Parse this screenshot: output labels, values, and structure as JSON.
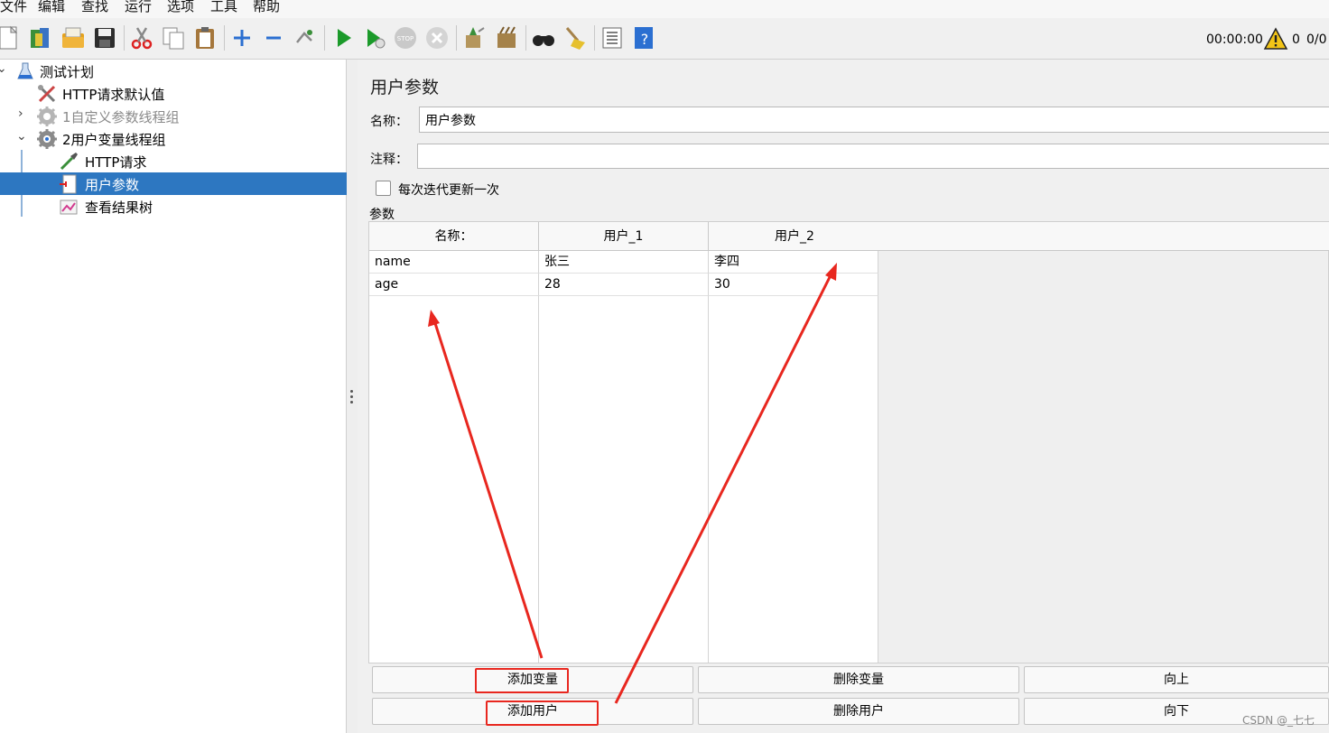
{
  "menu": [
    "文件",
    "编辑",
    "查找",
    "运行",
    "选项",
    "工具",
    "帮助"
  ],
  "toolbar": {
    "timer": "00:00:00",
    "warning_count": "0",
    "thread_count": "0/0"
  },
  "tree": {
    "items": [
      {
        "label": "测试计划",
        "icon": "flask-icon"
      },
      {
        "label": "HTTP请求默认值",
        "icon": "wrench-icon"
      },
      {
        "label": "1自定义参数线程组",
        "icon": "gear-icon"
      },
      {
        "label": "2用户变量线程组",
        "icon": "gear-icon"
      },
      {
        "label": "HTTP请求",
        "icon": "pipette-icon"
      },
      {
        "label": "用户参数",
        "icon": "document-icon"
      },
      {
        "label": "查看结果树",
        "icon": "chart-icon"
      }
    ],
    "selected": "用户参数"
  },
  "panel": {
    "title": "用户参数",
    "name_label": "名称：",
    "name_value": "用户参数",
    "comment_label": "注释：",
    "comment_value": "",
    "checkbox_label": "每次迭代更新一次",
    "params_label": "参数"
  },
  "table": {
    "headers": [
      "名称：",
      "用户_1",
      "用户_2"
    ],
    "rows": [
      [
        "name",
        "张三",
        "李四"
      ],
      [
        "age",
        "28",
        "30"
      ]
    ]
  },
  "buttons": {
    "add_variable": "添加变量",
    "delete_variable": "删除变量",
    "move_up": "向上",
    "add_user": "添加用户",
    "delete_user": "删除用户",
    "move_down": "向下"
  },
  "watermark": "CSDN @_七七",
  "colors": {
    "selection": "#2d77c1",
    "annotation": "#e8271f",
    "run_green": "#1b9a2a"
  }
}
